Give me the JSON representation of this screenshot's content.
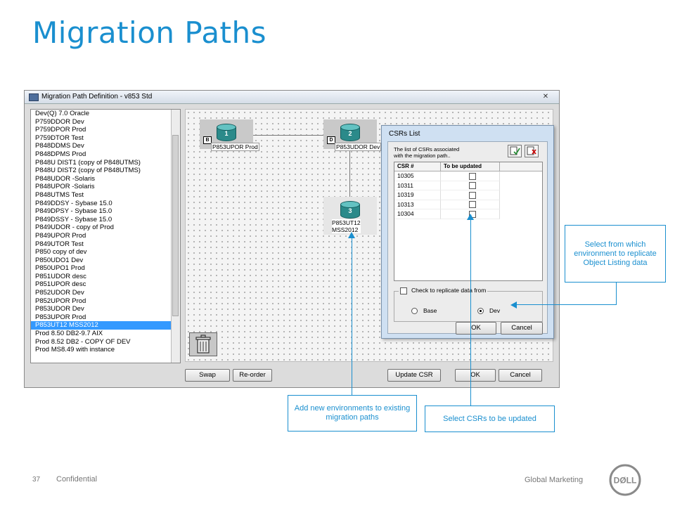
{
  "slide": {
    "title": "Migration Paths",
    "page_number": "37",
    "confidential": "Confidential",
    "global_marketing": "Global Marketing",
    "brand_color": "#1a8fcf"
  },
  "window": {
    "title": "Migration Path Definition - v853 Std",
    "close_glyph": "✕",
    "environments": [
      "Dev(Q) 7.0 Oracle",
      "P759DDOR Dev",
      "P759DPOR Prod",
      "P759DTOR Test",
      "P848DDMS Dev",
      "P848DPMS Prod",
      "P848U DIST1 (copy of P848UTMS)",
      "P848U DIST2 (copy of P848UTMS)",
      "P848UDOR -Solaris",
      "P848UPOR -Solaris",
      "P848UTMS Test",
      "P849DDSY - Sybase 15.0",
      "P849DPSY - Sybase 15.0",
      "P849DSSY - Sybase 15.0",
      "P849UDOR - copy of Prod",
      "P849UPOR Prod",
      "P849UTOR Test",
      "P850 copy of dev",
      "P850UDO1 Dev",
      "P850UPO1 Prod",
      "P851UDOR desc",
      "P851UPOR desc",
      "P852UDOR Dev",
      "P852UPOR Prod",
      "P853UDOR Dev",
      "P853UPOR Prod",
      "P853UT12 MSS2012",
      "Prod 8.50 DB2-9.7 AIX",
      "Prod 8.52 DB2 - COPY OF DEV",
      "Prod MS8.49 with instance"
    ],
    "selected_index": 26,
    "nodes": [
      {
        "number": "1",
        "badge": "B",
        "label": "P853UPOR Prod"
      },
      {
        "number": "2",
        "badge": "D",
        "label": "P853UDOR Dev"
      },
      {
        "number": "3",
        "label_line1": "P853UT12",
        "label_line2": "MSS2012"
      }
    ],
    "buttons": {
      "swap": "Swap",
      "reorder": "Re-order",
      "update_csr": "Update CSR",
      "ok": "OK",
      "cancel": "Cancel"
    }
  },
  "csr_dialog": {
    "title": "CSRs List",
    "description_line1": "The list of CSRs associated",
    "description_line2": "with the migration path..",
    "columns": [
      "CSR #",
      "To be updated"
    ],
    "rows": [
      "10305",
      "10311",
      "10319",
      "10313",
      "10304"
    ],
    "replicate_label": "Check to replicate data from",
    "radio_base": "Base",
    "radio_dev": "Dev",
    "ok": "OK",
    "cancel": "Cancel"
  },
  "callouts": {
    "replicate": "Select from which environment to replicate Object Listing data",
    "add_env": "Add new environments to existing migration paths",
    "select_csr": "Select CSRs to be updated"
  }
}
